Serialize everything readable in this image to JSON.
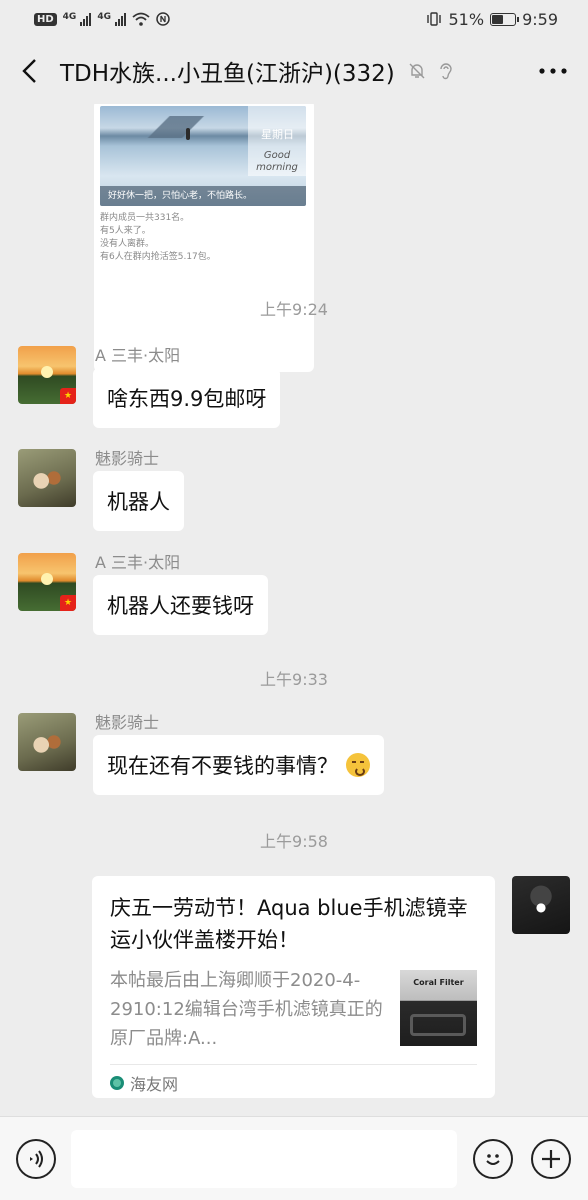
{
  "status_bar": {
    "hd_label": "HD",
    "net1": "4G",
    "net2": "4G",
    "battery_percent": "51%",
    "battery_level": 0.51,
    "time": "9:59"
  },
  "header": {
    "title": "TDH水族...小丑鱼(江浙沪)(332)",
    "icons": [
      "back-icon",
      "mute-bell-icon",
      "ear-icon",
      "more-icon"
    ]
  },
  "previous_card": {
    "weekday": "星期日",
    "greeting": "Good morning",
    "caption": "好好休一把，只怕心老，不怕路长。",
    "lines": [
      "群内成员一共331名。",
      "有5人来了。",
      "没有人离群。",
      "有6人在群内抢活签5.17包。"
    ]
  },
  "messages": [
    {
      "type": "time",
      "text": "上午9:24"
    },
    {
      "type": "chat",
      "sender": "A 三丰·太阳",
      "avatar": "sunset-avatar",
      "text": "啥东西9.9包邮呀"
    },
    {
      "type": "chat",
      "sender": "魅影骑士",
      "avatar": "dog-avatar",
      "text": "机器人"
    },
    {
      "type": "chat",
      "sender": "A 三丰·太阳",
      "avatar": "sunset-avatar",
      "text": "机器人还要钱呀"
    },
    {
      "type": "time",
      "text": "上午9:33"
    },
    {
      "type": "chat",
      "sender": "魅影骑士",
      "avatar": "dog-avatar",
      "text": "现在还有不要钱的事情？",
      "emoji": "shushing-face-icon"
    },
    {
      "type": "time",
      "text": "上午9:58"
    }
  ],
  "link_card": {
    "title": "庆五一劳动节！Aqua blue手机滤镜幸运小伙伴盖楼开始！",
    "description": "本帖最后由上海卿顺于2020-4-2910:12编辑台湾手机滤镜真正的原厂品牌:A...",
    "thumbnail_label": "Coral Filter",
    "source": "海友网"
  },
  "input_bar": {
    "placeholder": "",
    "icons": [
      "voice-icon",
      "emoji-icon",
      "plus-icon"
    ]
  },
  "colors": {
    "background": "#ededed",
    "bubble": "#ffffff",
    "timestamp": "#9b9b9b",
    "nickname": "#8c8c8c"
  }
}
